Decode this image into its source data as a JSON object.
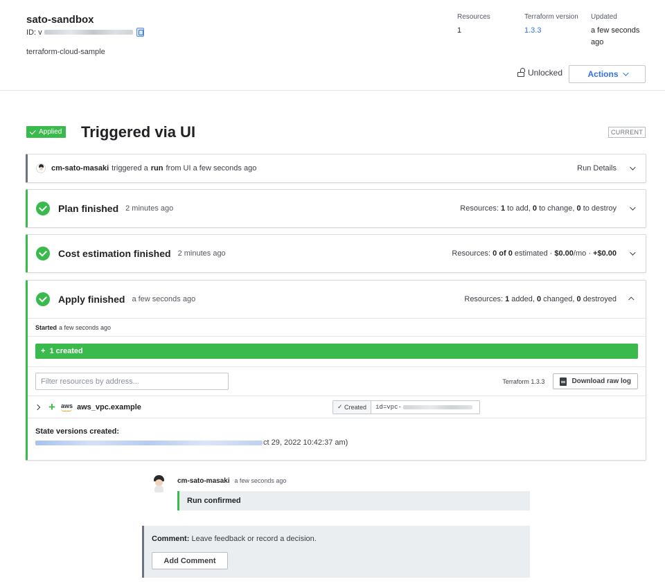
{
  "workspace": {
    "name": "sato-sandbox",
    "id_label": "ID: v",
    "organization": "terraform-cloud-sample"
  },
  "meta": {
    "resources_label": "Resources",
    "resources_value": "1",
    "tf_version_label": "Terraform version",
    "tf_version_value": "1.3.3",
    "updated_label": "Updated",
    "updated_value": "a few seconds ago"
  },
  "header_actions": {
    "unlocked_label": "Unlocked",
    "actions_label": "Actions"
  },
  "run": {
    "status_badge": "Applied",
    "title": "Triggered via UI",
    "current_tag": "CURRENT"
  },
  "trigger": {
    "user": "cm-sato-masaki",
    "text_before_run": "triggered a",
    "run_word": "run",
    "text_after_run": "from UI a few seconds ago",
    "details_label": "Run Details"
  },
  "plan": {
    "title": "Plan finished",
    "time": "2 minutes ago",
    "summary_prefix": "Resources:",
    "add_count": "1",
    "add_label": "to add,",
    "change_count": "0",
    "change_label": "to change,",
    "destroy_count": "0",
    "destroy_label": "to destroy"
  },
  "cost": {
    "title": "Cost estimation finished",
    "time": "2 minutes ago",
    "summary_prefix": "Resources:",
    "estimated_count": "0 of 0",
    "estimated_label": "estimated ·",
    "monthly": "$0.00",
    "monthly_suffix": "/mo ·",
    "delta": "+$0.00"
  },
  "apply": {
    "title": "Apply finished",
    "time": "a few seconds ago",
    "summary_prefix": "Resources:",
    "added_count": "1",
    "added_label": "added,",
    "changed_count": "0",
    "changed_label": "changed,",
    "destroyed_count": "0",
    "destroyed_label": "destroyed",
    "started_label": "Started",
    "started_time": "a few seconds ago",
    "created_bar": "1 created",
    "filter_placeholder": "Filter resources by address...",
    "tf_version_text": "Terraform 1.3.3",
    "download_label": "Download raw log",
    "resource": {
      "provider": "aws",
      "name": "aws_vpc.example",
      "status": "Created",
      "id_prefix": "id=vpc-"
    },
    "state_title": "State versions created:",
    "state_suffix": "ct 29, 2022 10:42:37 am)"
  },
  "comment_entry": {
    "author": "cm-sato-masaki",
    "time": "a few seconds ago",
    "body": "Run confirmed"
  },
  "comment_box": {
    "label": "Comment:",
    "hint": "Leave feedback or record a decision.",
    "button": "Add Comment"
  },
  "colors": {
    "success": "#3ab94c",
    "link": "#2e71e5",
    "border": "#d6d9de"
  }
}
